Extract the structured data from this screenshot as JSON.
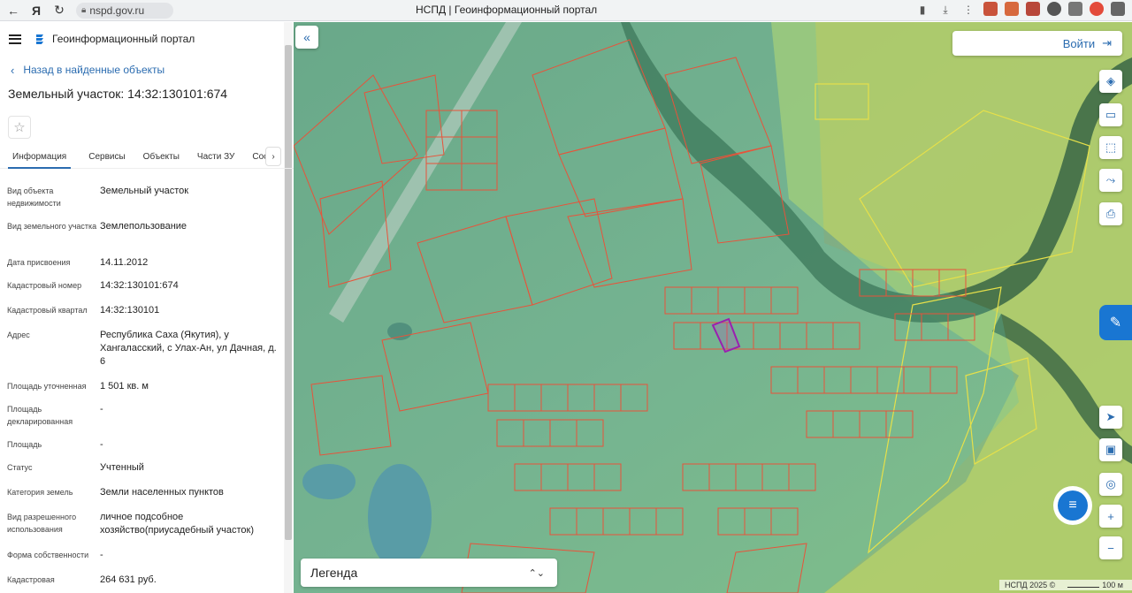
{
  "browser": {
    "url": "nspd.gov.ru",
    "tab_title": "НСПД | Геоинформационный портал"
  },
  "panel": {
    "portal_title": "Геоинформационный портал",
    "back_label": "Назад в найденные объекты",
    "object_title": "Земельный участок: 14:32:130101:674",
    "tabs": [
      {
        "label": "Информация"
      },
      {
        "label": "Сервисы"
      },
      {
        "label": "Объекты"
      },
      {
        "label": "Части ЗУ"
      },
      {
        "label": "Соста"
      }
    ],
    "attributes": [
      {
        "label": "Вид объекта недвижимости",
        "value": "Земельный участок"
      },
      {
        "label": "Вид земельного участка",
        "value": "Землепользование"
      },
      {
        "label": "Дата присвоения",
        "value": "14.11.2012"
      },
      {
        "label": "Кадастровый номер",
        "value": "14:32:130101:674"
      },
      {
        "label": "Кадастровый квартал",
        "value": "14:32:130101"
      },
      {
        "label": "Адрес",
        "value": "Республика Саха (Якутия), у Хангаласский, с Улах-Ан, ул Дачная, д. 6"
      },
      {
        "label": "Площадь уточненная",
        "value": "1 501 кв. м"
      },
      {
        "label": "Площадь декларированная",
        "value": "-"
      },
      {
        "label": "Площадь",
        "value": "-"
      },
      {
        "label": "Статус",
        "value": "Учтенный"
      },
      {
        "label": "Категория земель",
        "value": "Земли населенных пунктов"
      },
      {
        "label": "Вид разрешенного использования",
        "value": "личное подсобное хозяйство(приусадебный участок)"
      },
      {
        "label": "Форма собственности",
        "value": "-"
      },
      {
        "label": "Кадастровая",
        "value": "264 631 руб."
      }
    ]
  },
  "map": {
    "login_label": "Войти",
    "legend_label": "Легенда",
    "attribution": "НСПД 2025 ©",
    "scale_label": "100 м",
    "colors": {
      "parcel_outline": "#e8533a",
      "selected_parcel": "#9b1fb0",
      "accent": "#1976d2"
    }
  }
}
